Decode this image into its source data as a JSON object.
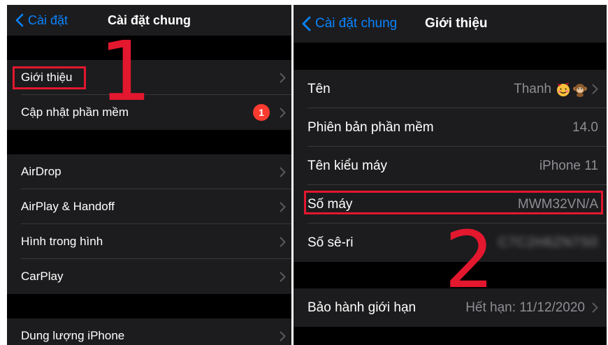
{
  "left": {
    "back_label": "Cài đặt",
    "title": "Cài đặt chung",
    "groups": [
      {
        "items": [
          {
            "label": "Giới thiệu"
          },
          {
            "label": "Cập nhật phần mềm",
            "badge": "1"
          }
        ]
      },
      {
        "items": [
          {
            "label": "AirDrop"
          },
          {
            "label": "AirPlay & Handoff"
          },
          {
            "label": "Hình trong hình"
          },
          {
            "label": "CarPlay"
          }
        ]
      },
      {
        "items": [
          {
            "label": "Dung lượng iPhone"
          }
        ]
      }
    ],
    "annotation_number": "1"
  },
  "right": {
    "back_label": "Cài đặt chung",
    "title": "Giới thiệu",
    "groups": [
      {
        "items": [
          {
            "label": "Tên",
            "value": "Thanh"
          },
          {
            "label": "Phiên bản phần mềm",
            "value": "14.0"
          },
          {
            "label": "Tên kiểu máy",
            "value": "iPhone 11"
          },
          {
            "label": "Số máy",
            "value": "MWM32VN/A"
          },
          {
            "label": "Số sê-ri",
            "value": "C7C2H6ZN7S0"
          }
        ]
      },
      {
        "items": [
          {
            "label": "Bảo hành giới hạn",
            "value": "Hết hạn: 11/12/2020"
          }
        ]
      }
    ],
    "annotation_number": "2"
  },
  "colors": {
    "background": "#000000",
    "cell": "#1c1c1e",
    "separator": "#38383a",
    "accent": "#0a84ff",
    "secondary_text": "#8e8e93",
    "badge": "#ff3b30",
    "annotation": "#e3172e"
  },
  "icons": [
    "chevron-left-icon",
    "chevron-right-icon",
    "smiling-face-with-hearts-emoji",
    "monkey-emoji"
  ]
}
